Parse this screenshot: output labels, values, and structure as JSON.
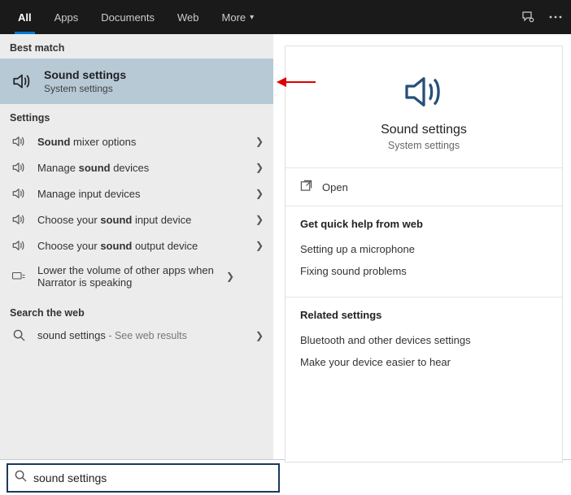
{
  "topbar": {
    "tabs": [
      {
        "label": "All",
        "active": true
      },
      {
        "label": "Apps"
      },
      {
        "label": "Documents"
      },
      {
        "label": "Web"
      },
      {
        "label": "More",
        "dropdown": true
      }
    ]
  },
  "left": {
    "best_match_label": "Best match",
    "best_match": {
      "title": "Sound settings",
      "subtitle": "System settings"
    },
    "settings_label": "Settings",
    "settings_items": [
      {
        "prefix": "",
        "bold": "Sound",
        "suffix": " mixer options"
      },
      {
        "prefix": "Manage ",
        "bold": "sound",
        "suffix": " devices"
      },
      {
        "prefix": "Manage input devices",
        "bold": "",
        "suffix": ""
      },
      {
        "prefix": "Choose your ",
        "bold": "sound",
        "suffix": " input device"
      },
      {
        "prefix": "Choose your ",
        "bold": "sound",
        "suffix": " output device"
      },
      {
        "prefix": "Lower the volume of other apps when Narrator is speaking",
        "bold": "",
        "suffix": "",
        "icon": "narrator"
      }
    ],
    "web_label": "Search the web",
    "web_item": {
      "text": "sound settings",
      "note": " - See web results"
    }
  },
  "right": {
    "hero_title": "Sound settings",
    "hero_sub": "System settings",
    "open_label": "Open",
    "quick_help_head": "Get quick help from web",
    "quick_help": [
      "Setting up a microphone",
      "Fixing sound problems"
    ],
    "related_head": "Related settings",
    "related": [
      "Bluetooth and other devices settings",
      "Make your device easier to hear"
    ]
  },
  "search": {
    "value": "sound settings"
  }
}
